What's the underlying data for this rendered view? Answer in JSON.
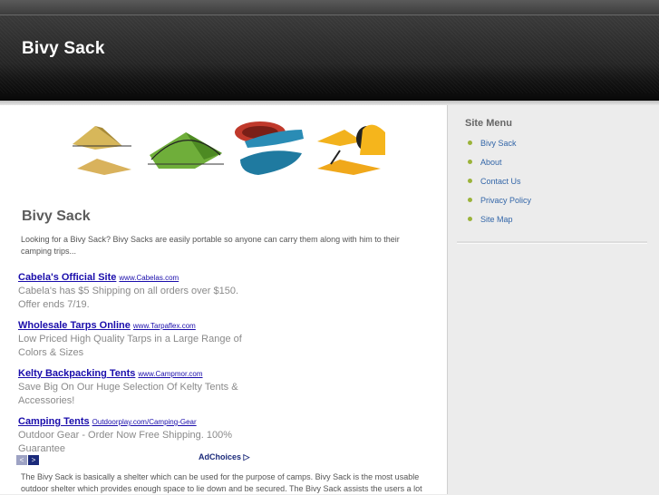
{
  "site": {
    "title": "Bivy Sack"
  },
  "hero": {
    "icon_names": [
      "bivy-tent-icon",
      "green-tent-icon",
      "blue-sleeping-bag-icon",
      "yellow-bivy-icon"
    ]
  },
  "main": {
    "heading": "Bivy Sack",
    "intro": "Looking for a Bivy Sack? Bivy Sacks are easily portable so anyone can carry them along with him to their camping trips...",
    "body": "The Bivy Sack is basically a shelter which can be used for the purpose of camps. Bivy Sack is the most usable outdoor shelter which provides enough space to lie down and be secured. The Bivy Sack assists the users a lot"
  },
  "ads": {
    "items": [
      {
        "title": "Cabela's Official Site",
        "url": "www.Cabelas.com",
        "desc": "Cabela's has $5 Shipping on all orders over $150. Offer ends 7/19."
      },
      {
        "title": "Wholesale Tarps Online",
        "url": "www.Tarpaflex.com",
        "desc": "Low Priced High Quality Tarps in a Large Range of Colors & Sizes"
      },
      {
        "title": "Kelty Backpacking Tents",
        "url": "www.Campmor.com",
        "desc": "Save Big On Our Huge Selection Of Kelty Tents & Accessories!"
      },
      {
        "title": "Camping Tents",
        "url": "Outdoorplay.com/Camping-Gear",
        "desc": "Outdoor Gear - Order Now Free Shipping. 100% Guarantee"
      }
    ],
    "prev": "<",
    "next": ">",
    "adchoices": "AdChoices"
  },
  "sidebar": {
    "title": "Site Menu",
    "items": [
      "Bivy Sack",
      "About",
      "Contact Us",
      "Privacy Policy",
      "Site Map"
    ]
  },
  "colors": {
    "link": "#1a0dab",
    "menu_link": "#3366a8",
    "bullet": "#9bb33a",
    "header": "#262626"
  }
}
